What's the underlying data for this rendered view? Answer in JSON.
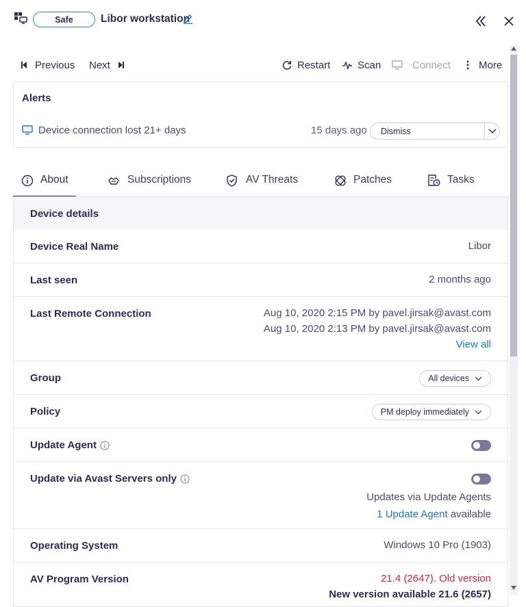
{
  "header": {
    "os_icon": "windows-device-icon",
    "status_badge": "Safe",
    "device_title": "Libor workstation",
    "edit_icon": "pencil-icon",
    "collapse_icon": "double-chevron-left-icon",
    "close_icon": "close-icon"
  },
  "toolbar": {
    "previous_label": "Previous",
    "next_label": "Next",
    "restart_label": "Restart",
    "scan_label": "Scan",
    "connect_label": "Connect",
    "more_label": "More"
  },
  "alerts": {
    "title": "Alerts",
    "items": [
      {
        "icon": "monitor-icon",
        "text": "Device connection lost 21+ days",
        "time": "15 days ago",
        "action_selected": "Dismiss"
      }
    ]
  },
  "tabs": [
    {
      "label": "About",
      "icon": "info-circle-icon",
      "active": true
    },
    {
      "label": "Subscriptions",
      "icon": "subscriptions-icon",
      "active": false
    },
    {
      "label": "AV Threats",
      "icon": "shield-check-icon",
      "active": false
    },
    {
      "label": "Patches",
      "icon": "patches-icon",
      "active": false
    },
    {
      "label": "Tasks",
      "icon": "tasks-clock-icon",
      "active": false
    }
  ],
  "details": {
    "section_title": "Device details",
    "device_real_name": {
      "label": "Device Real Name",
      "value": "Libor"
    },
    "last_seen": {
      "label": "Last seen",
      "value": "2 months ago"
    },
    "last_remote": {
      "label": "Last Remote Connection",
      "entries": [
        "Aug 10, 2020 2:15 PM by pavel.jirsak@avast.com",
        "Aug 10, 2020 2:13 PM by pavel.jirsak@avast.com"
      ],
      "view_all": "View all"
    },
    "group": {
      "label": "Group",
      "value": "All devices"
    },
    "policy": {
      "label": "Policy",
      "value": "PM deploy immediately"
    },
    "update_agent": {
      "label": "Update Agent",
      "enabled": false
    },
    "update_via_avast": {
      "label": "Update via Avast Servers only",
      "enabled": false,
      "note": "Updates via Update Agents",
      "agent_link": "1 Update Agent",
      "agent_suffix": "available"
    },
    "operating_system": {
      "label": "Operating System",
      "value": "Windows 10 Pro (1903)"
    },
    "av_program": {
      "label": "AV Program Version",
      "value": "21.4 (2647). Old version",
      "new_version": "New version available 21.6 (2657)"
    }
  },
  "colors": {
    "text": "#2c2b53",
    "accent_link": "#1d78c7",
    "safe_green": "#2f9e6e",
    "warning_red": "#d0263b"
  }
}
